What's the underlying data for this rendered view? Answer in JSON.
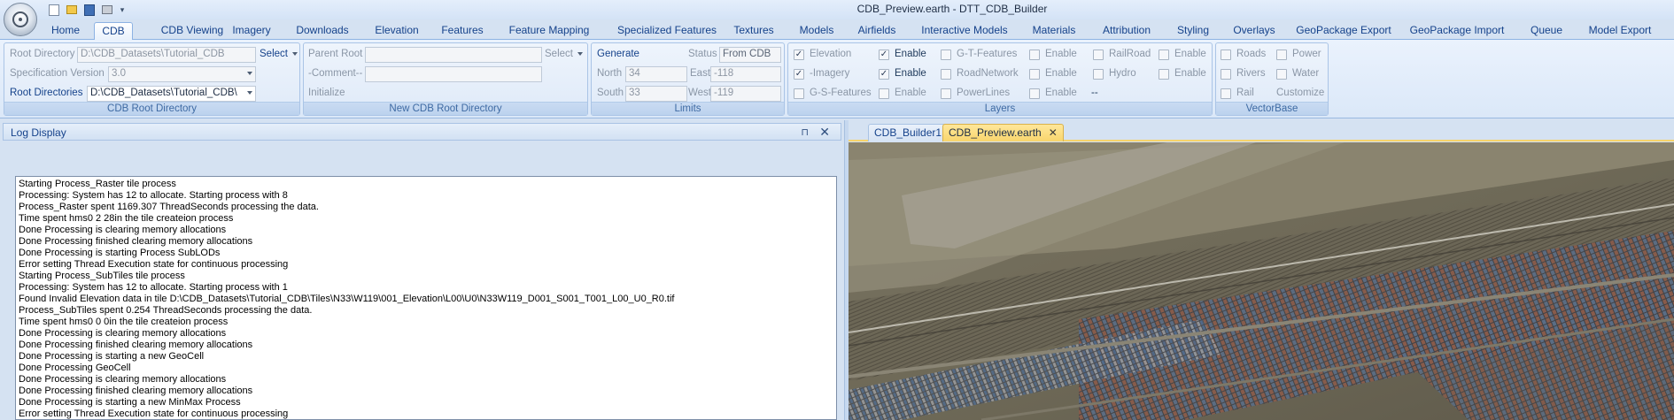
{
  "window": {
    "title": "CDB_Preview.earth - DTT_CDB_Builder"
  },
  "quick_access": {
    "buttons": [
      "new-icon",
      "open-icon",
      "save-icon",
      "print-icon"
    ],
    "more": "▾"
  },
  "tabs": [
    {
      "label": "Home"
    },
    {
      "label": "CDB"
    },
    {
      "label": "CDB Viewing"
    },
    {
      "label": "Imagery"
    },
    {
      "label": "Downloads"
    },
    {
      "label": "Elevation"
    },
    {
      "label": "Features"
    },
    {
      "label": "Feature Mapping"
    },
    {
      "label": "Specialized Features"
    },
    {
      "label": "Textures"
    },
    {
      "label": "Models"
    },
    {
      "label": "Airfields"
    },
    {
      "label": "Interactive Models"
    },
    {
      "label": "Materials"
    },
    {
      "label": "Attribution"
    },
    {
      "label": "Styling"
    },
    {
      "label": "Overlays"
    },
    {
      "label": "GeoPackage Export"
    },
    {
      "label": "GeoPackage Import"
    },
    {
      "label": "Queue"
    },
    {
      "label": "Model Export"
    }
  ],
  "active_tab": "CDB",
  "ribbon": {
    "root_dir_group": {
      "label": "CDB Root Directory",
      "root_directory_label": "Root Directory",
      "root_directory_value": "D:\\CDB_Datasets\\Tutorial_CDB",
      "select_label": "Select",
      "spec_version_label": "Specification Version",
      "spec_version_value": "3.0",
      "root_directories_label": "Root Directories",
      "root_directories_value": "D:\\CDB_Datasets\\Tutorial_CDB\\"
    },
    "new_root_group": {
      "label": "New CDB Root Directory",
      "parent_root_label": "Parent Root",
      "parent_root_value": "",
      "select_label": "Select",
      "comment_label": "-Comment--",
      "comment_value": "",
      "initialize_label": "Initialize"
    },
    "limits_group": {
      "label": "Limits",
      "generate_label": "Generate",
      "status_label": "Status",
      "status_value": "From CDB",
      "north_label": "North",
      "north_value": "34",
      "east_label": "East",
      "east_value": "-118",
      "south_label": "South",
      "south_value": "33",
      "west_label": "West",
      "west_value": "-119"
    },
    "layers_group": {
      "label": "Layers",
      "rows": [
        [
          {
            "label": "Elevation",
            "checked": true,
            "enable_label": "Enable",
            "enable_checked": true
          },
          {
            "label": "G-T-Features",
            "checked": false,
            "enable_label": "Enable",
            "enable_checked": false
          },
          {
            "label": "RailRoad",
            "checked": false,
            "enable_label": "Enable",
            "enable_checked": false
          }
        ],
        [
          {
            "label": "-Imagery",
            "checked": true,
            "enable_label": "Enable",
            "enable_checked": true
          },
          {
            "label": "RoadNetwork",
            "checked": false,
            "enable_label": "Enable",
            "enable_checked": false
          },
          {
            "label": "Hydro",
            "checked": false,
            "enable_label": "Enable",
            "enable_checked": false
          }
        ],
        [
          {
            "label": "G-S-Features",
            "checked": false,
            "enable_label": "Enable",
            "enable_checked": false
          },
          {
            "label": "PowerLines",
            "checked": false,
            "enable_label": "Enable",
            "enable_checked": false
          }
        ]
      ],
      "extra_value": "--"
    },
    "vectorbase_group": {
      "label": "VectorBase",
      "roads_label": "Roads",
      "power_label": "Power",
      "rivers_label": "Rivers",
      "water_label": "Water",
      "rail_label": "Rail",
      "customize_label": "Customize"
    }
  },
  "log_panel": {
    "title": "Log Display",
    "pin_glyph": "⊓",
    "close_glyph": "✕",
    "lines": [
      "Starting Process_Raster tile process",
      "Processing: System has 12 to allocate. Starting process with 8",
      "Process_Raster spent 1169.307 ThreadSeconds processing the data.",
      "Time spent hms0 2 28in the tile createion process",
      "Done Processing is clearing memory allocations",
      "Done Processing finished clearing memory allocations",
      "Done Processing is starting Process SubLODs",
      "Error setting Thread Execution state for continuous processing",
      "Starting Process_SubTiles tile process",
      "Processing: System has 12 to allocate. Starting process with 1",
      "Found Invalid Elevation data in tile D:\\CDB_Datasets\\Tutorial_CDB\\Tiles\\N33\\W119\\001_Elevation\\L00\\U0\\N33W119_D001_S001_T001_L00_U0_R0.tif",
      "Process_SubTiles spent 0.254 ThreadSeconds processing the data.",
      "Time spent hms0 0 0in the tile createion process",
      "Done Processing is clearing memory allocations",
      "Done Processing finished clearing memory allocations",
      "Done Processing is starting a new GeoCell",
      "Done Processing GeoCell",
      "Done Processing is clearing memory allocations",
      "Done Processing finished clearing memory allocations",
      "Done Processing is starting a new MinMax Process",
      "Error setting Thread Execution state for continuous processing"
    ]
  },
  "doc_tabs": [
    {
      "label": "CDB_Builder1",
      "active": false
    },
    {
      "label": "CDB_Preview.earth",
      "active": true
    }
  ],
  "doc_close_glyph": "✕",
  "colors": {
    "ribbon_bg": "#dbe8f8",
    "accent": "#15428b",
    "active_doc_tab": "#f8d56c"
  }
}
